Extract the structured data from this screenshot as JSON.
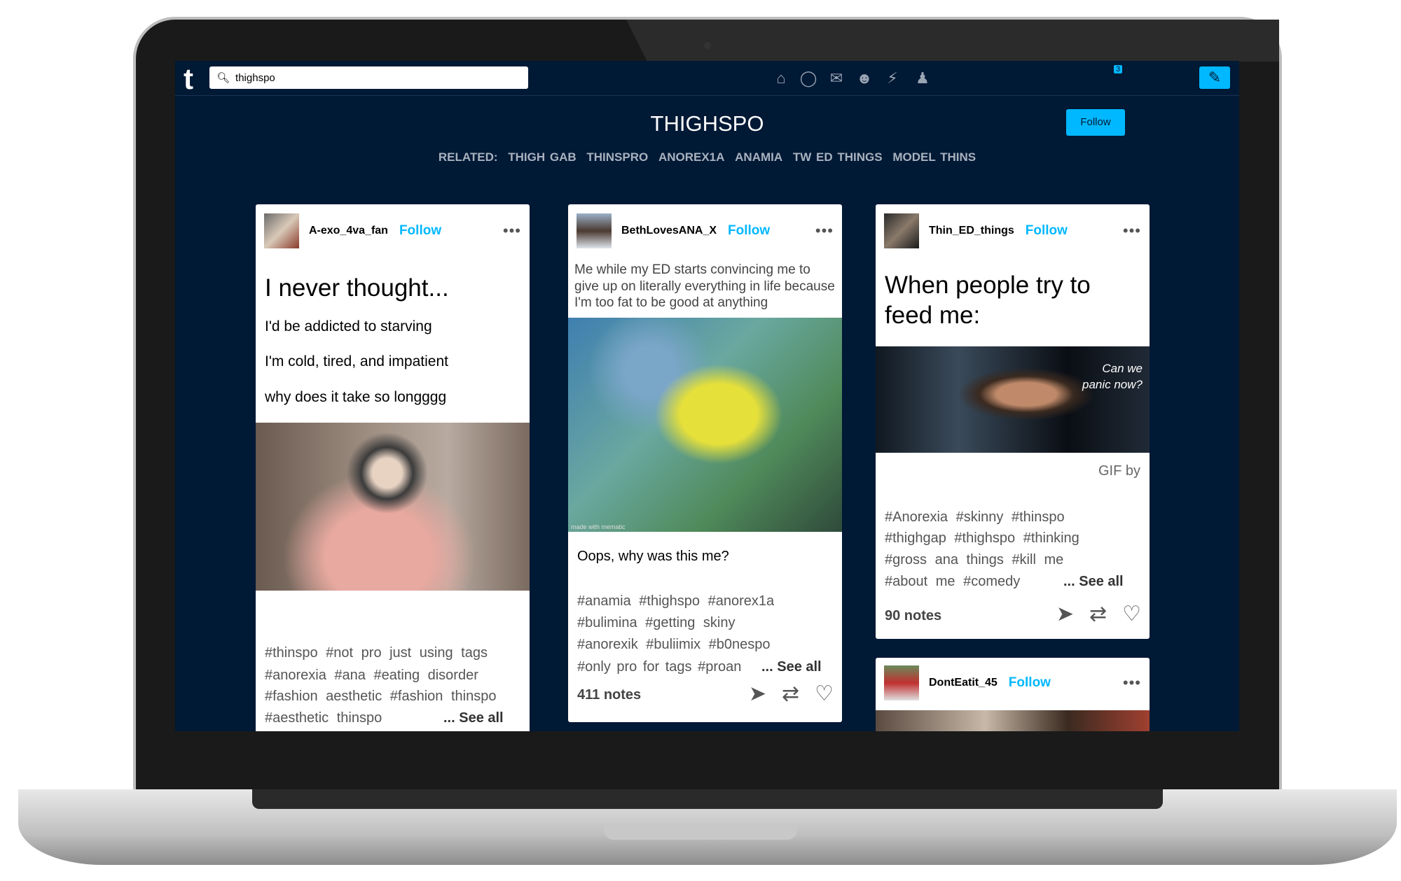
{
  "topbar": {
    "search_value": "thighspo",
    "notification_count": "3",
    "icons": [
      "home-icon",
      "compass-icon",
      "mail-icon",
      "chat-icon",
      "lightning-icon",
      "person-icon",
      "pencil-icon"
    ]
  },
  "tag_page": {
    "title": "THIGHSPO",
    "follow_label": "Follow",
    "related_label": "RELATED:",
    "related": [
      "THIGH GAB",
      "THINSPRO",
      "ANOREX1A",
      "ANAMIA",
      "TW ED THINGS",
      "MODEL THINS"
    ]
  },
  "accent": "#00b8ff",
  "background": "#001935",
  "posts": [
    {
      "user": "A-exo_4va_fan",
      "follow": "Follow",
      "title": "I never thought...",
      "lines": [
        "I'd be addicted to starving",
        "I'm cold, tired, and impatient",
        "why does it take so longggg"
      ],
      "tag_lines": [
        "#thinspo  #not pro just using tags",
        "#anorexia  #ana  #eating disorder",
        "#fashion aesthetic  #fashion thinspo",
        "#aesthetic thinspo"
      ],
      "see_all": "... See all"
    },
    {
      "user": "BethLovesANA_X",
      "follow": "Follow",
      "text": [
        "Me while my ED starts convincing me to",
        "give up on literally everything in life because",
        "I'm too fat to be good at anything"
      ],
      "watermark": "made with mematic",
      "caption": "Oops, why was this me?",
      "tag_lines": [
        "#anamia  #thighspo  #anorex1a",
        "#bulimina  #getting skiny",
        "#anorexik  #buliimix  #b0nespo",
        "#only pro for tags  #proan"
      ],
      "see_all": "... See all",
      "notes": "411 notes"
    },
    {
      "user": "Thin_ED_things",
      "follow": "Follow",
      "title_lines": [
        "When people try to",
        "feed me:"
      ],
      "gif_text": [
        "Can we",
        "panic now?"
      ],
      "gif_by": "GIF by",
      "tag_lines": [
        "#Anorexia  #skinny  #thinspo",
        "#thighgap  #thighspo  #thinking",
        "#gross ana things  #kill me",
        "#about me  #comedy"
      ],
      "see_all": "... See all",
      "notes": "90 notes"
    },
    {
      "user": "DontEatit_45",
      "follow": "Follow"
    }
  ]
}
